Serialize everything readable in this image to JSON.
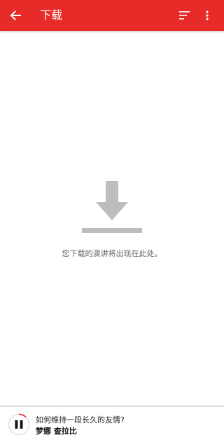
{
  "colors": {
    "app_bar": "#e62b28",
    "icon_gray": "#bdbdbd",
    "progress_red": "#e62b28"
  },
  "header": {
    "title": "下载",
    "back_icon": "arrow-left-icon",
    "sort_icon": "sort-icon",
    "more_icon": "more-vertical-icon"
  },
  "empty_state": {
    "icon": "download-icon",
    "message": "您下载的演讲将出现在此处。"
  },
  "player": {
    "talk_title": "如何维持一段长久的友情?",
    "speaker": "梦娜 查拉比",
    "state_icon": "pause-icon",
    "progress": 0.12
  }
}
